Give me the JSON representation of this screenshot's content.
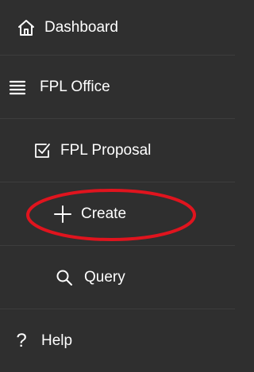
{
  "nav": {
    "items": [
      {
        "key": "dashboard",
        "label": "Dashboard",
        "icon": "home-icon"
      },
      {
        "key": "fpl-office",
        "label": "FPL Office",
        "icon": "list-icon"
      },
      {
        "key": "fpl-proposal",
        "label": "FPL Proposal",
        "icon": "checkbox-icon"
      },
      {
        "key": "create",
        "label": "Create",
        "icon": "plus-icon"
      },
      {
        "key": "query",
        "label": "Query",
        "icon": "search-icon"
      },
      {
        "key": "help",
        "label": "Help",
        "icon": "help-icon",
        "glyph": "?"
      }
    ]
  },
  "colors": {
    "background": "#2f2f2f",
    "text": "#ffffff",
    "divider": "#3d3d3d",
    "highlight": "#e0141e"
  }
}
